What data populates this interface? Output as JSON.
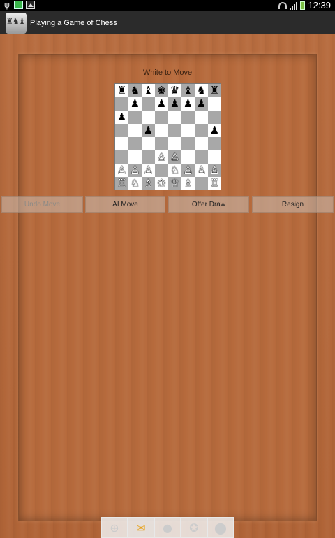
{
  "status_bar": {
    "time": "12:39",
    "icons": [
      "usb-icon",
      "app-notification-icon",
      "gallery-icon",
      "wifi-icon",
      "signal-icon",
      "battery-icon"
    ]
  },
  "action_bar": {
    "title": "Playing a Game of Chess",
    "icon": "chess-app-icon"
  },
  "game": {
    "turn_label": "White to Move",
    "board": [
      [
        "♜",
        "♞",
        "♝",
        "♚",
        "♛",
        "♝",
        "♞",
        "♜"
      ],
      [
        "",
        "♟",
        "",
        "♟",
        "♟",
        "♟",
        "♟",
        ""
      ],
      [
        "♟",
        "",
        "",
        "",
        "",
        "",
        "",
        ""
      ],
      [
        "",
        "",
        "♟",
        "",
        "",
        "",
        "",
        "♟"
      ],
      [
        "",
        "",
        "",
        "",
        "",
        "",
        "",
        ""
      ],
      [
        "",
        "",
        "",
        "♙",
        "♙",
        "",
        "",
        ""
      ],
      [
        "♙",
        "♙",
        "♙",
        "",
        "♘",
        "♙",
        "♙",
        "♙"
      ],
      [
        "♖",
        "♘",
        "♗",
        "♔",
        "♕",
        "♗",
        "",
        "♖"
      ]
    ],
    "colors": {
      "light_square": "#ffffff",
      "dark_square": "#a8a8a8"
    }
  },
  "buttons": {
    "undo": "Undo Move",
    "ai_move": "AI Move",
    "offer_draw": "Offer Draw",
    "resign": "Resign"
  },
  "dock": {
    "items": [
      "add-icon",
      "mail-icon",
      "contact-icon",
      "badge-icon",
      "location-icon"
    ]
  }
}
